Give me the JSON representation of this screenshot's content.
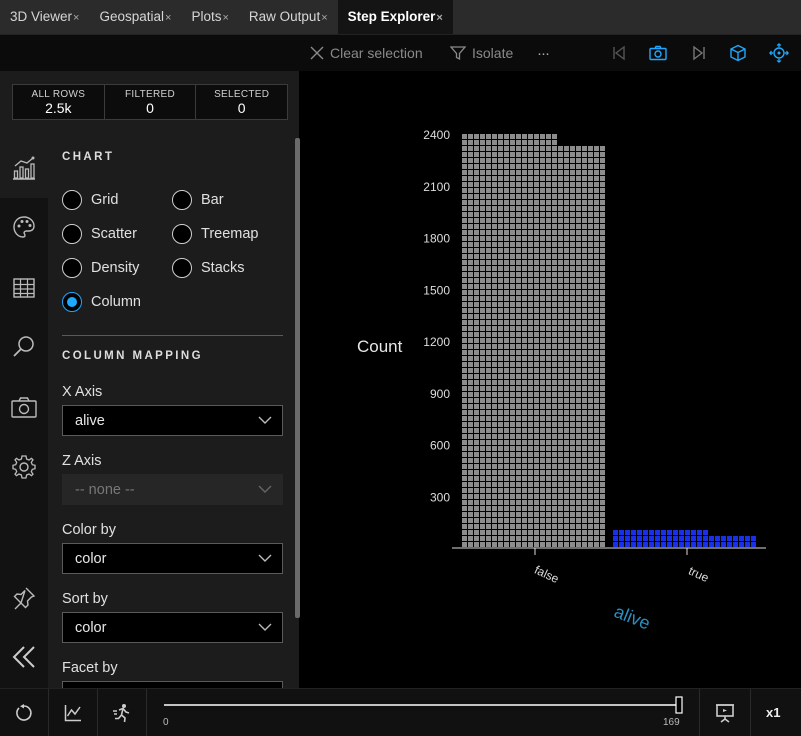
{
  "tabs": [
    {
      "label": "3D Viewer",
      "close": "×"
    },
    {
      "label": "Geospatial",
      "close": "×"
    },
    {
      "label": "Plots",
      "close": "×"
    },
    {
      "label": "Raw Output",
      "close": "×"
    },
    {
      "label": "Step Explorer",
      "close": "×",
      "active": true
    }
  ],
  "toolbar": {
    "clear_label": "Clear selection",
    "isolate_label": "Isolate",
    "more_label": "···"
  },
  "stats": [
    {
      "label": "ALL ROWS",
      "value": "2.5k"
    },
    {
      "label": "FILTERED",
      "value": "0"
    },
    {
      "label": "SELECTED",
      "value": "0"
    }
  ],
  "chart_section": {
    "title": "CHART",
    "options": [
      "Grid",
      "Bar",
      "Scatter",
      "Treemap",
      "Density",
      "Stacks",
      "Column"
    ],
    "selected": "Column"
  },
  "mapping": {
    "title": "COLUMN MAPPING",
    "x_axis_label": "X Axis",
    "x_axis_value": "alive",
    "z_axis_label": "Z Axis",
    "z_axis_value": "-- none --",
    "color_label": "Color by",
    "color_value": "color",
    "sort_label": "Sort by",
    "sort_value": "color",
    "facet_label": "Facet by"
  },
  "colors": {
    "accent": "#1fa8ff",
    "gray_bar": "#8c8c8c",
    "blue_bar": "#1a2fe8",
    "axis_label": "#2a8fc2"
  },
  "chart_data": {
    "type": "bar",
    "categories": [
      "false",
      "true"
    ],
    "series": [
      {
        "color": "#8c8c8c",
        "values": [
          2400,
          0
        ]
      },
      {
        "color": "#1a2fe8",
        "values": [
          0,
          130
        ]
      }
    ],
    "ylabel": "Count",
    "xlabel": "alive",
    "yticks": [
      300,
      600,
      900,
      1200,
      1500,
      1800,
      2100,
      2400
    ],
    "ylim": [
      0,
      2400
    ],
    "grid": false
  },
  "bottom": {
    "timeline_start": "0",
    "timeline_end": "169",
    "timeline_position": 1.0,
    "speed_label": "x1"
  }
}
